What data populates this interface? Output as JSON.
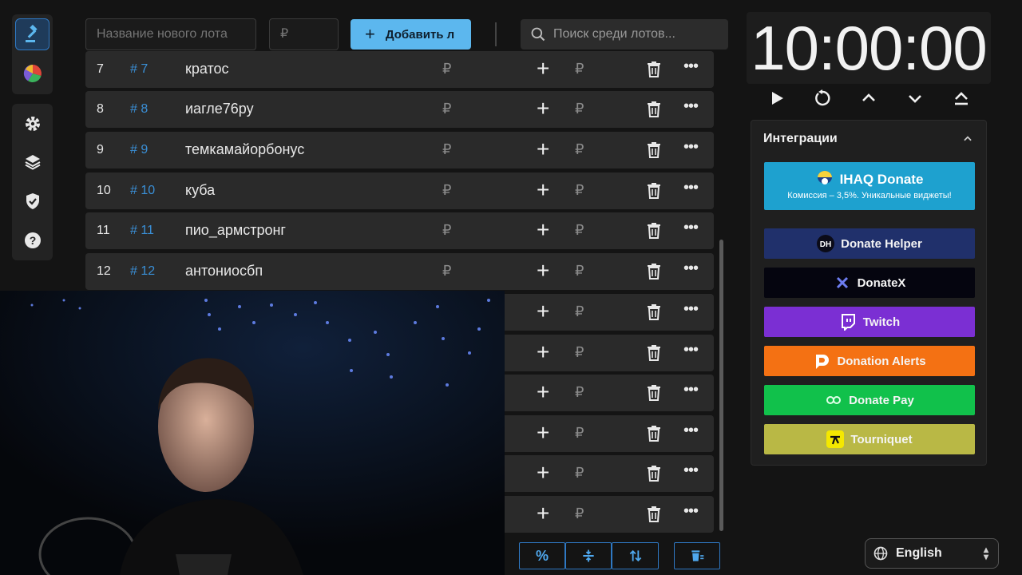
{
  "topbar": {
    "lot_name_placeholder": "Название нового лота",
    "amount_placeholder": "₽",
    "add_label": "Добавить л",
    "search_placeholder": "Поиск среди лотов..."
  },
  "lots": [
    {
      "num": "7",
      "id": "# 7",
      "name": "кратос",
      "sum": "₽",
      "add": "+",
      "add_rub": "₽",
      "more": "•••"
    },
    {
      "num": "8",
      "id": "# 8",
      "name": "иагле76ру",
      "sum": "₽",
      "add": "+",
      "add_rub": "₽",
      "more": "•••"
    },
    {
      "num": "9",
      "id": "# 9",
      "name": "темкамайорбонус",
      "sum": "₽",
      "add": "+",
      "add_rub": "₽",
      "more": "•••"
    },
    {
      "num": "10",
      "id": "# 10",
      "name": "куба",
      "sum": "₽",
      "add": "+",
      "add_rub": "₽",
      "more": "•••"
    },
    {
      "num": "11",
      "id": "# 11",
      "name": "пио_армстронг",
      "sum": "₽",
      "add": "+",
      "add_rub": "₽",
      "more": "•••"
    },
    {
      "num": "12",
      "id": "# 12",
      "name": "антониосбп",
      "sum": "₽",
      "add": "+",
      "add_rub": "₽",
      "more": "•••"
    },
    {
      "num": "",
      "id": "",
      "name": "",
      "sum": "",
      "add": "+",
      "add_rub": "₽",
      "more": "•••"
    },
    {
      "num": "",
      "id": "",
      "name": "",
      "sum": "",
      "add": "+",
      "add_rub": "₽",
      "more": "•••"
    },
    {
      "num": "",
      "id": "",
      "name": "",
      "sum": "",
      "add": "+",
      "add_rub": "₽",
      "more": "•••"
    },
    {
      "num": "",
      "id": "",
      "name": "",
      "sum": "",
      "add": "+",
      "add_rub": "₽",
      "more": "•••"
    },
    {
      "num": "",
      "id": "",
      "name": "",
      "sum": "",
      "add": "+",
      "add_rub": "₽",
      "more": "•••"
    },
    {
      "num": "",
      "id": "",
      "name": "",
      "sum": "",
      "add": "+",
      "add_rub": "₽",
      "more": "•••"
    }
  ],
  "toolbar": {
    "percent_label": "%"
  },
  "timer": {
    "value": "10:00:00"
  },
  "integrations": {
    "title": "Интеграции",
    "ihaq": {
      "title": "IHAQ Donate",
      "subtitle": "Комиссия – 3,5%. Уникальные виджеты!"
    },
    "buttons": [
      {
        "label": "Donate Helper",
        "icon": "donate-helper-icon",
        "color": "#20306b"
      },
      {
        "label": "DonateX",
        "icon": "donatex-icon",
        "color": "#05050f"
      },
      {
        "label": "Twitch",
        "icon": "twitch-icon",
        "color": "#7b2fd3"
      },
      {
        "label": "Donation Alerts",
        "icon": "donation-alerts-icon",
        "color": "#f47113"
      },
      {
        "label": "Donate Pay",
        "icon": "donate-pay-icon",
        "color": "#11c14b"
      },
      {
        "label": "Tourniquet",
        "icon": "tourniquet-icon",
        "color": "#b9b845"
      }
    ]
  },
  "language": {
    "selected": "English"
  },
  "colors": {
    "accent": "#5cb7ee",
    "id_blue": "#3a8fd6",
    "background": "#141414"
  }
}
